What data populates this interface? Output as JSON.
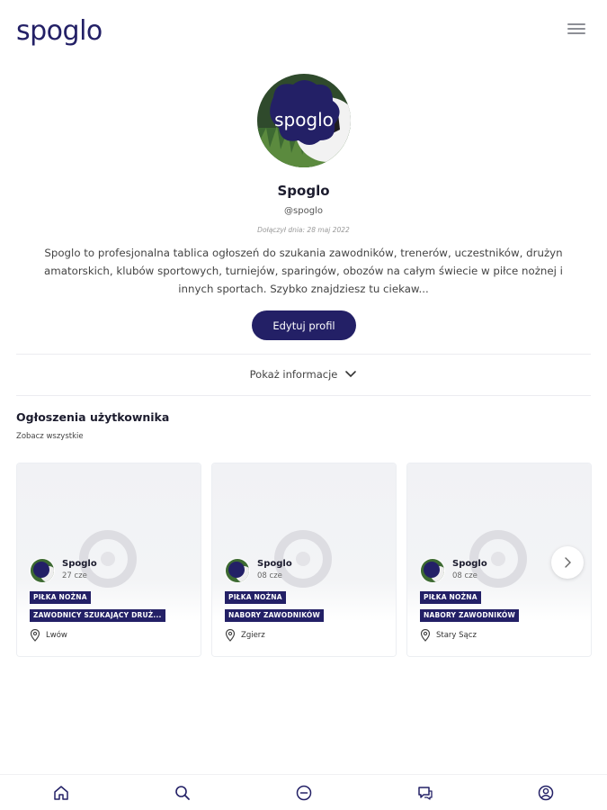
{
  "header": {
    "logo_text": "spoglo",
    "menu_icon": "hamburger-menu-icon"
  },
  "profile": {
    "avatar_logo_text": "spoglo",
    "name": "Spoglo",
    "handle": "@spoglo",
    "joined": "Dołączył dnia: 28 maj 2022",
    "bio": "Spoglo to profesjonalna tablica ogłoszeń do szukania zawodników, trenerów, uczestników, drużyn amatorskich, klubów sportowych, turniejów, sparingów, obozów na całym świecie w piłce nożnej i innych sportach. Szybko znajdziesz tu ciekaw...",
    "edit_button": "Edytuj profil",
    "show_info": "Pokaż informacje"
  },
  "listings": {
    "title": "Ogłoszenia użytkownika",
    "see_all": "Zobacz wszystkie",
    "cards": [
      {
        "user": "Spoglo",
        "date": "27 cze",
        "sport": "PIŁKA NOŻNA",
        "category": "ZAWODNICY SZUKAJĄCY DRUŻ...",
        "location": "Lwów"
      },
      {
        "user": "Spoglo",
        "date": "08 cze",
        "sport": "PIŁKA NOŻNA",
        "category": "NABORY ZAWODNIKÓW",
        "location": "Zgierz"
      },
      {
        "user": "Spoglo",
        "date": "08 cze",
        "sport": "PIŁKA NOŻNA",
        "category": "NABORY ZAWODNIKÓW",
        "location": "Stary Sącz"
      }
    ]
  },
  "bottom_nav": [
    "home-icon",
    "search-icon",
    "add-icon",
    "messages-icon",
    "profile-icon"
  ],
  "colors": {
    "brand": "#232066",
    "text": "#1c1c2e",
    "muted": "#8d8f96"
  }
}
